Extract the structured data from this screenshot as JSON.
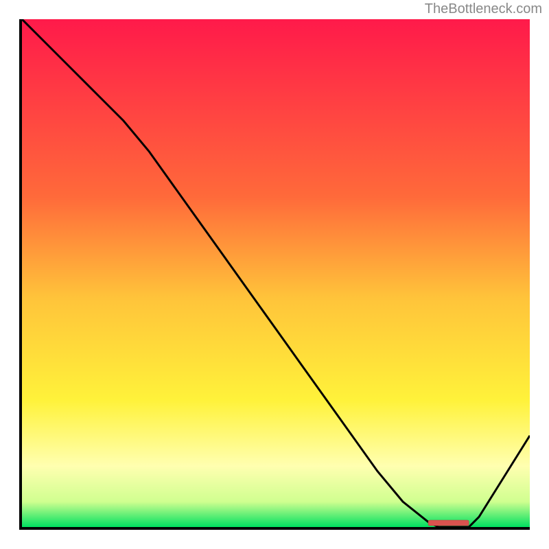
{
  "watermark": "TheBottleneck.com",
  "chart_data": {
    "type": "line",
    "title": "",
    "xlabel": "",
    "ylabel": "",
    "xlim": [
      0,
      100
    ],
    "ylim": [
      0,
      100
    ],
    "x": [
      0,
      5,
      10,
      15,
      20,
      25,
      30,
      35,
      40,
      45,
      50,
      55,
      60,
      65,
      70,
      75,
      80,
      82,
      85,
      88,
      90,
      95,
      100
    ],
    "values": [
      100,
      95,
      90,
      85,
      80,
      74,
      67,
      60,
      53,
      46,
      39,
      32,
      25,
      18,
      11,
      5,
      1,
      0,
      0,
      0,
      2,
      10,
      18
    ],
    "marker_range_x": [
      80,
      88
    ],
    "gradient_stops": [
      {
        "offset": 0,
        "color": "#ff1a4a"
      },
      {
        "offset": 0.35,
        "color": "#ff6a3a"
      },
      {
        "offset": 0.55,
        "color": "#ffc43a"
      },
      {
        "offset": 0.75,
        "color": "#fff23a"
      },
      {
        "offset": 0.88,
        "color": "#ffffb0"
      },
      {
        "offset": 0.95,
        "color": "#d0ff90"
      },
      {
        "offset": 1.0,
        "color": "#00e060"
      }
    ]
  }
}
